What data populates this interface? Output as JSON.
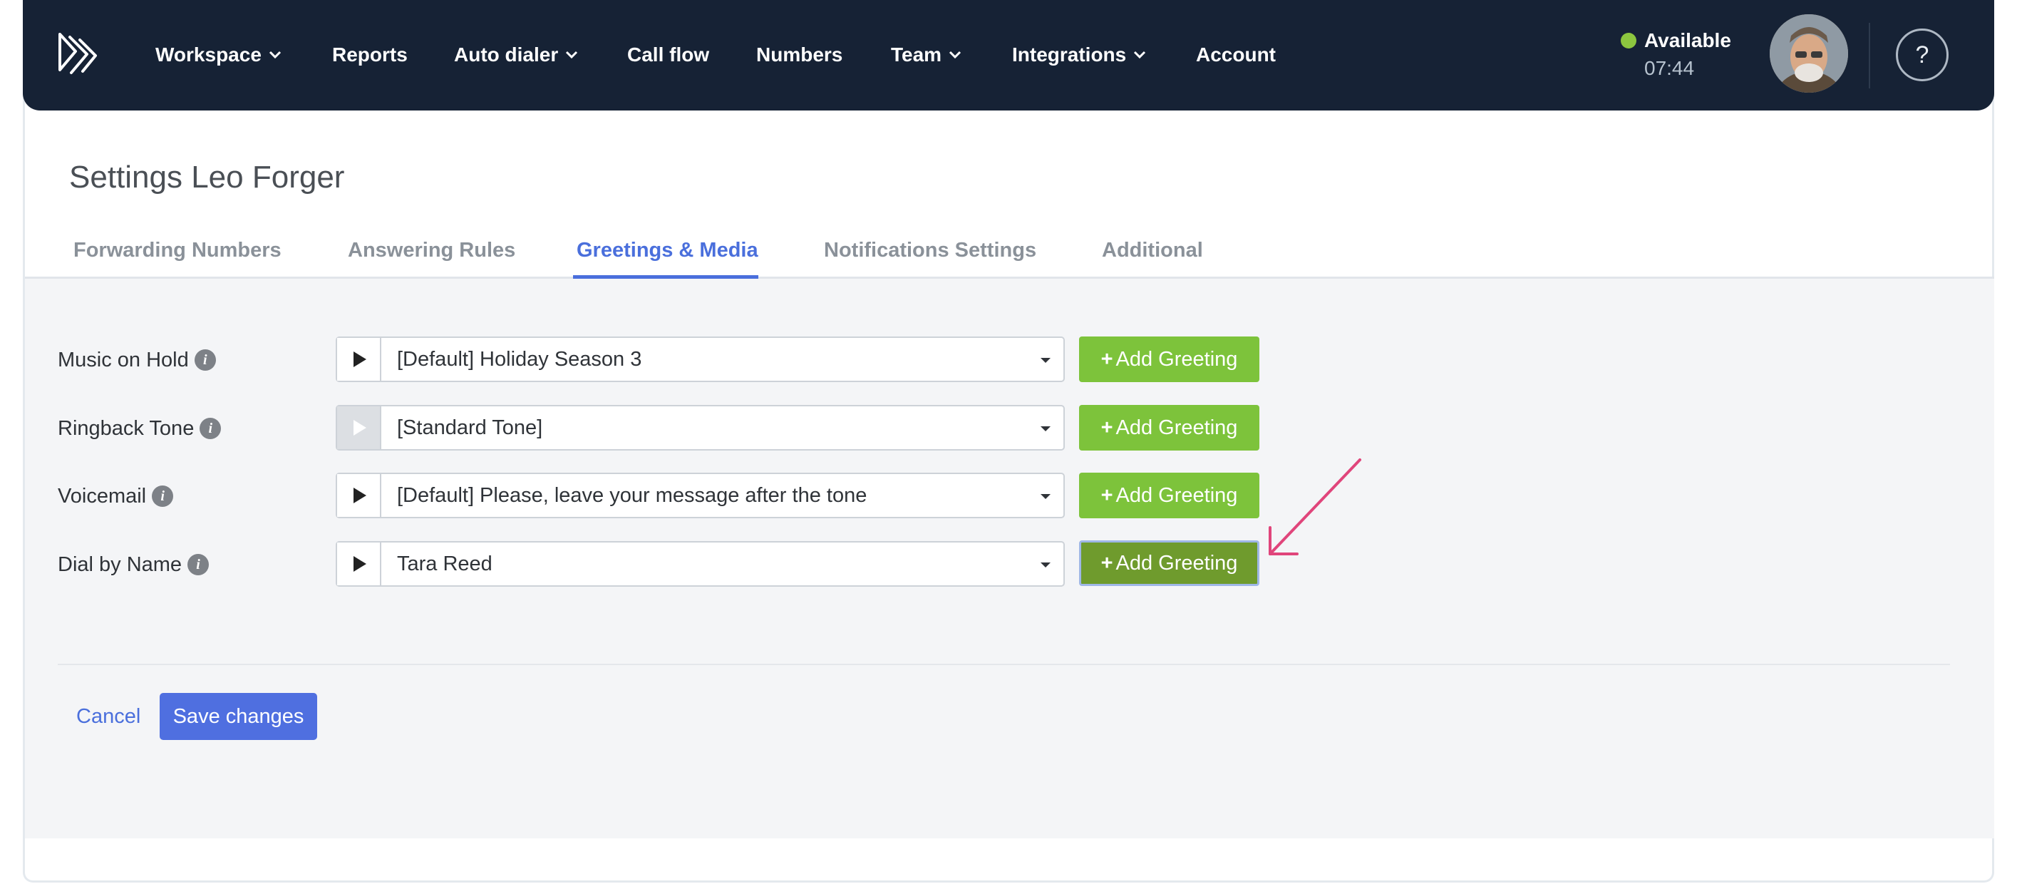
{
  "nav": {
    "items": [
      {
        "label": "Workspace",
        "dropdown": true
      },
      {
        "label": "Reports",
        "dropdown": false
      },
      {
        "label": "Auto dialer",
        "dropdown": true
      },
      {
        "label": "Call flow",
        "dropdown": false
      },
      {
        "label": "Numbers",
        "dropdown": false
      },
      {
        "label": "Team",
        "dropdown": true
      },
      {
        "label": "Integrations",
        "dropdown": true
      },
      {
        "label": "Account",
        "dropdown": false
      }
    ],
    "status": {
      "label": "Available",
      "time": "07:44",
      "color": "#8cc63f"
    },
    "help_icon": "?"
  },
  "page": {
    "title": "Settings Leo Forger"
  },
  "tabs": [
    {
      "label": "Forwarding Numbers",
      "active": false
    },
    {
      "label": "Answering Rules",
      "active": false
    },
    {
      "label": "Greetings & Media",
      "active": true
    },
    {
      "label": "Notifications Settings",
      "active": false
    },
    {
      "label": "Additional",
      "active": false
    }
  ],
  "rows": [
    {
      "label": "Music on Hold",
      "selected": "[Default] Holiday Season 3",
      "play_enabled": true,
      "button": "Add Greeting"
    },
    {
      "label": "Ringback Tone",
      "selected": "[Standard Tone]",
      "play_enabled": false,
      "button": "Add Greeting"
    },
    {
      "label": "Voicemail",
      "selected": "[Default] Please, leave your message after the tone",
      "play_enabled": true,
      "button": "Add Greeting"
    },
    {
      "label": "Dial by Name",
      "selected": "Tara Reed",
      "play_enabled": true,
      "button": "Add Greeting"
    }
  ],
  "actions": {
    "cancel": "Cancel",
    "save": "Save changes"
  },
  "colors": {
    "navbar": "#162235",
    "accent": "#4a6fdc",
    "add_button": "#7dc33b",
    "add_button_focused": "#6f9b2d",
    "save_button": "#4f6fe0",
    "annotation": "#e0457b"
  }
}
